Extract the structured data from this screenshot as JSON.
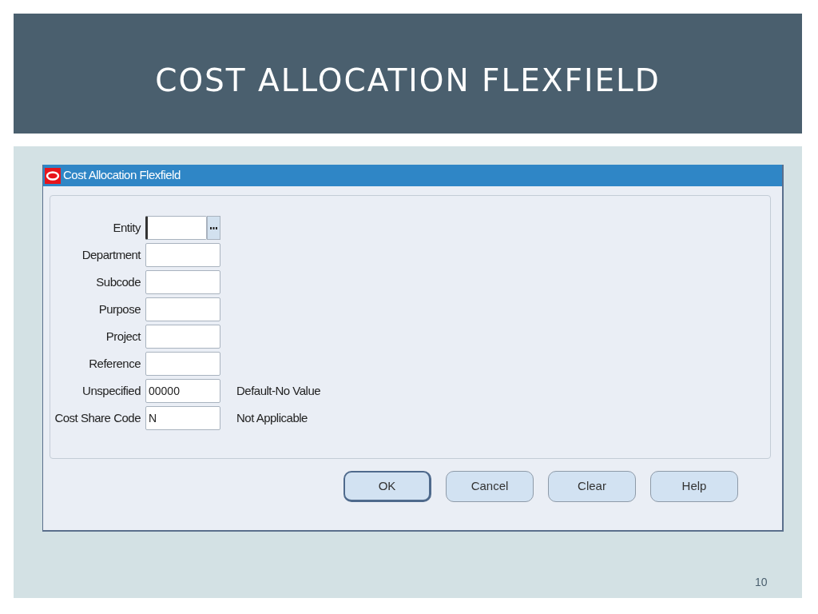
{
  "slide": {
    "title": "COST ALLOCATION FLEXFIELD",
    "page_number": "10"
  },
  "window": {
    "title": "Cost Allocation Flexfield"
  },
  "fields": [
    {
      "label": "Entity",
      "focused": true,
      "has_list_button": true
    },
    {
      "label": "Department",
      "focused": false,
      "has_list_button": false
    },
    {
      "label": "Subcode",
      "focused": false,
      "has_list_button": false
    },
    {
      "label": "Purpose",
      "focused": false,
      "has_list_button": false
    },
    {
      "label": "Project",
      "focused": false,
      "has_list_button": false
    },
    {
      "label": "Reference",
      "focused": false,
      "has_list_button": false
    },
    {
      "label": "Unspecified",
      "value": "00000",
      "focused": false,
      "has_list_button": false,
      "description": "Default-No Value"
    },
    {
      "label": "Cost Share Code",
      "value": "N",
      "focused": false,
      "has_list_button": false,
      "description": "Not Applicable"
    }
  ],
  "buttons": [
    {
      "label": "OK",
      "default": true
    },
    {
      "label": "Cancel",
      "default": false
    },
    {
      "label": "Clear",
      "default": false
    },
    {
      "label": "Help",
      "default": false
    }
  ]
}
